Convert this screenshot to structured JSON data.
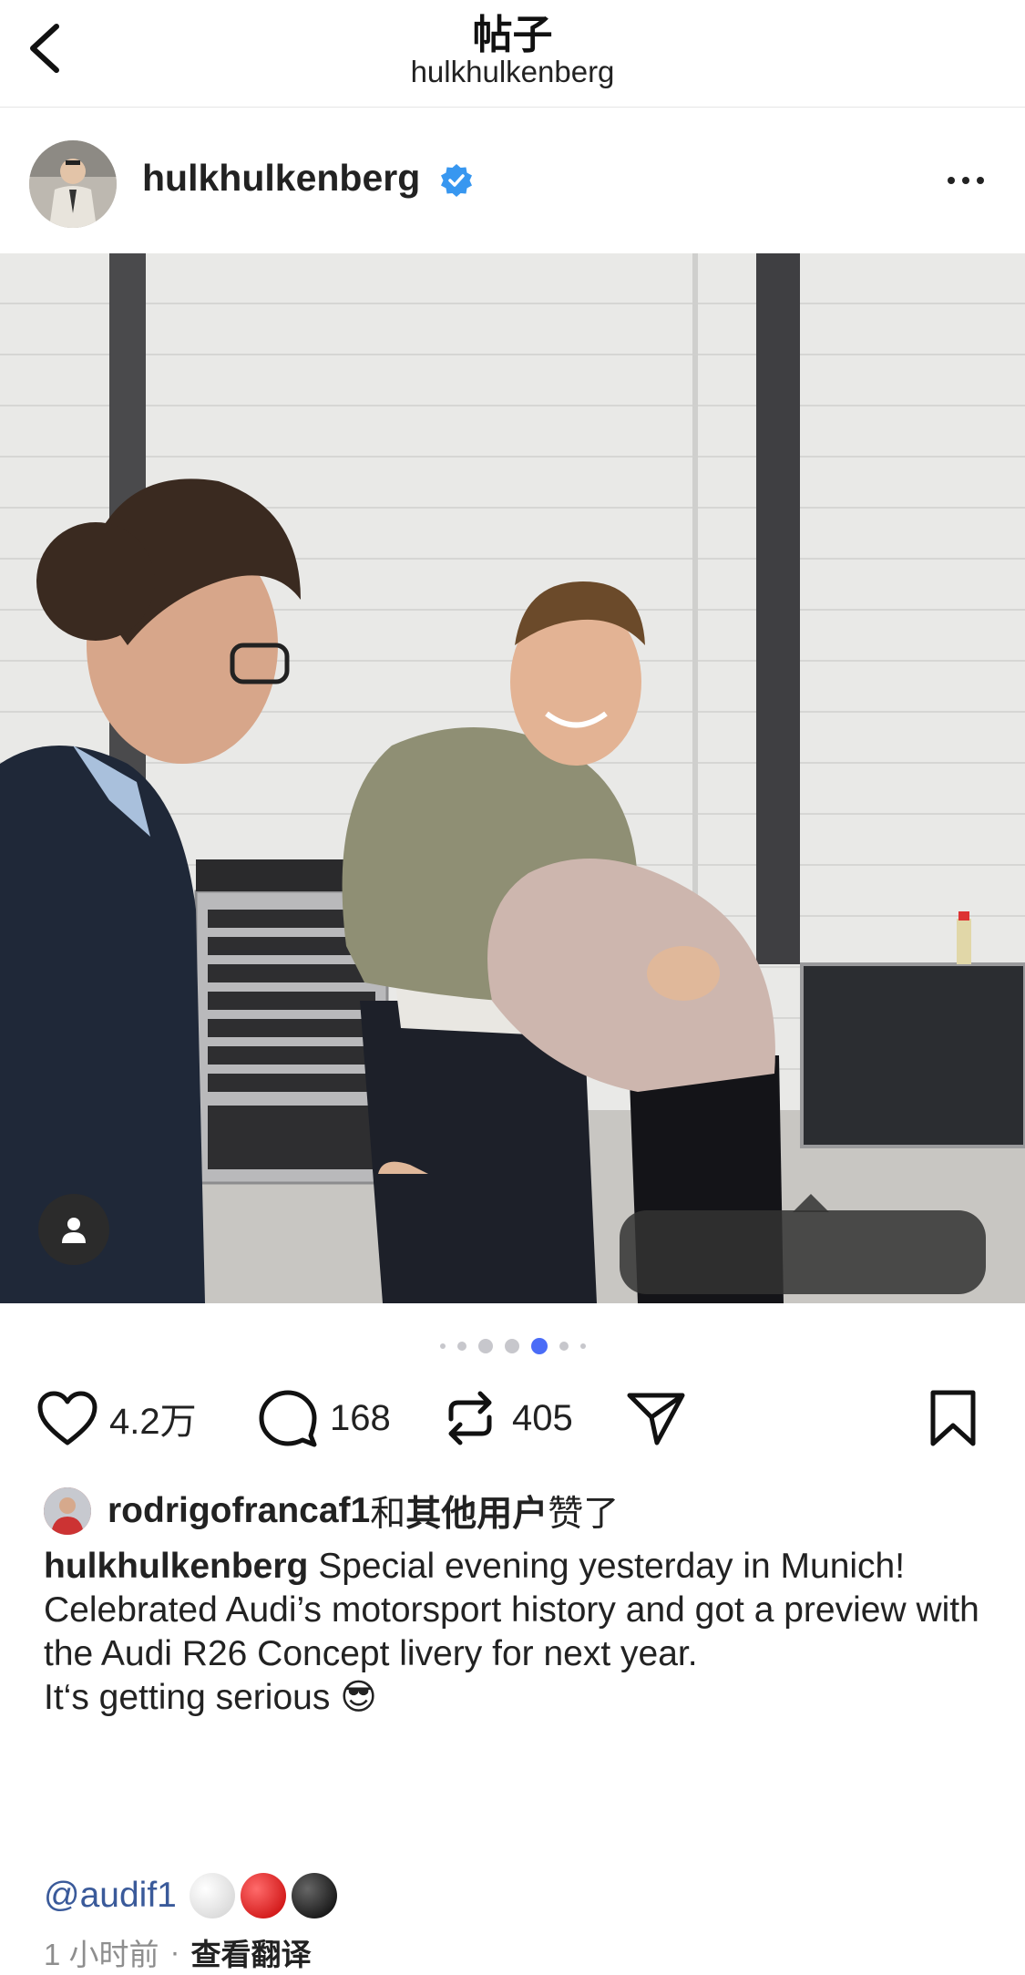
{
  "nav": {
    "title": "帖子",
    "subtitle": "hulkhulkenberg",
    "back_icon": "chevron-left-icon"
  },
  "post": {
    "username": "hulkhulkenberg",
    "verified_color": "#3897f0",
    "more_icon": "more-horizontal-icon"
  },
  "photo": {
    "page_count": 7,
    "active_index": 4,
    "accent": "#4a6cf7"
  },
  "actions": {
    "like_count": "4.2万",
    "comment_count": "168",
    "repost_count": "405"
  },
  "likes": {
    "user": "rodrigofrancaf1",
    "connector": "和",
    "others": "其他用户",
    "suffix": "赞了"
  },
  "caption": {
    "user": "hulkhulkenberg",
    "line1": "Special evening yesterday in Munich!",
    "line2": "Celebrated Audi’s motorsport history and got a preview with the Audi R26 Concept livery for next year.",
    "line3": "It‘s getting serious 😎",
    "mention": "@audif1",
    "mention_color": "#3a5a9a"
  },
  "meta": {
    "time": "1 小时前",
    "separator": "·",
    "translate": "查看翻译"
  }
}
